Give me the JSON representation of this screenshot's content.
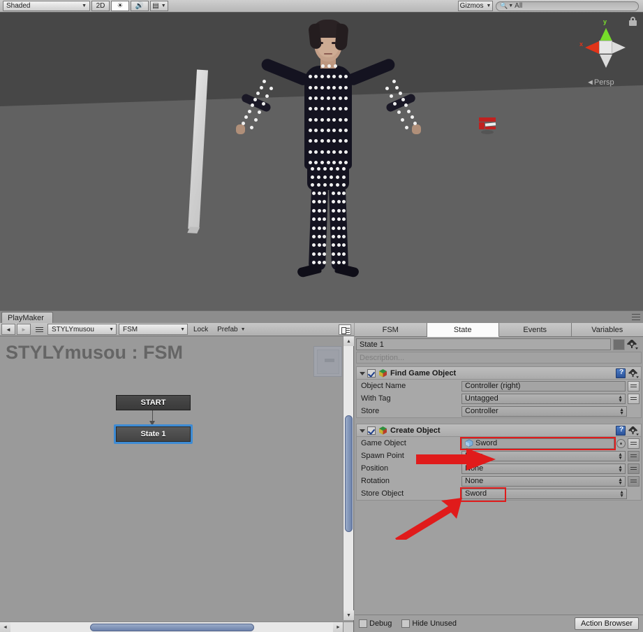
{
  "scene": {
    "toolbar": {
      "shading_mode": "Shaded",
      "mode_2d": "2D",
      "lighting_icon": "sun-icon",
      "audio_icon": "speaker-icon",
      "fx_icon": "image-icon",
      "gizmos_label": "Gizmos",
      "search_placeholder": "All",
      "search_icon": "search-icon"
    },
    "gizmo": {
      "axis_y": "y",
      "axis_x": "x",
      "projection": "Persp",
      "projection_prefix": "◄",
      "lock_icon": "lock-icon",
      "color_y": "#76dd2a",
      "color_x": "#e03419",
      "color_z": "#dcdcdc"
    },
    "colors": {
      "sky": "#474747",
      "ground": "#616161"
    },
    "objects": {
      "character_name": "mocap-suit-character",
      "slab_name": "white-sword-slab",
      "red_prefab_name": "red-sword-prefab"
    }
  },
  "playmaker": {
    "window_tab": "PlayMaker",
    "graph_toolbar": {
      "back_icon": "◄",
      "forward_icon": "►",
      "menu_icon": "hamburger-icon",
      "object_selector": "STYLYmusou",
      "fsm_selector": "FSM",
      "lock_label": "Lock",
      "prefab_label": "Prefab",
      "minimap_toggle_icon": "minimap-icon"
    },
    "graph": {
      "title": "STYLYmusou : FSM",
      "nodes": [
        {
          "label": "START",
          "selected": false
        },
        {
          "label": "State 1",
          "selected": true
        }
      ],
      "selection_color": "#3d8bd4"
    },
    "inspector": {
      "tabs": [
        {
          "label": "FSM",
          "active": false
        },
        {
          "label": "State",
          "active": true
        },
        {
          "label": "Events",
          "active": false
        },
        {
          "label": "Variables",
          "active": false
        }
      ],
      "state_name": "State 1",
      "state_color_swatch": "#6e6e6e",
      "settings_icon": "gear-icon",
      "description_placeholder": "Description...",
      "actions": [
        {
          "title": "Find Game Object",
          "enabled": true,
          "expanded": true,
          "icon": "playmaker-cube-icon",
          "help_icon": "help-book-icon",
          "menu_icon": "gear-icon",
          "fields": [
            {
              "label": "Object Name",
              "value": "Controller (right)",
              "control": "text",
              "side_button": "equals-icon",
              "highlight": false
            },
            {
              "label": "With Tag",
              "value": "Untagged",
              "control": "popup",
              "side_button": "equals-icon",
              "highlight": false
            },
            {
              "label": "Store",
              "value": "Controller",
              "control": "popup",
              "side_button": "none",
              "highlight": false
            }
          ]
        },
        {
          "title": "Create Object",
          "enabled": true,
          "expanded": true,
          "icon": "playmaker-cube-icon",
          "help_icon": "help-book-icon",
          "menu_icon": "gear-icon",
          "fields": [
            {
              "label": "Game Object",
              "value": "Sword",
              "control": "object",
              "side_button": "equals-icon",
              "highlight": true,
              "object_icon": "prefab-cube-icon"
            },
            {
              "label": "Spawn Point",
              "value": "None",
              "control": "popup",
              "side_button": "equals-dark-icon",
              "highlight": false
            },
            {
              "label": "Position",
              "value": "None",
              "control": "popup",
              "side_button": "equals-dark-icon",
              "highlight": false
            },
            {
              "label": "Rotation",
              "value": "None",
              "control": "popup",
              "side_button": "equals-dark-icon",
              "highlight": false
            },
            {
              "label": "Store Object",
              "value": "Sword",
              "control": "popup",
              "side_button": "none",
              "highlight": true
            }
          ]
        }
      ],
      "footer": {
        "debug_label": "Debug",
        "debug_checked": false,
        "hide_unused_label": "Hide Unused",
        "hide_unused_checked": false,
        "action_browser_label": "Action Browser"
      }
    },
    "annotations": {
      "arrow_color": "#e01b1b",
      "arrow_1_name": "callout-arrow-game-object",
      "arrow_2_name": "callout-arrow-store-object"
    }
  }
}
